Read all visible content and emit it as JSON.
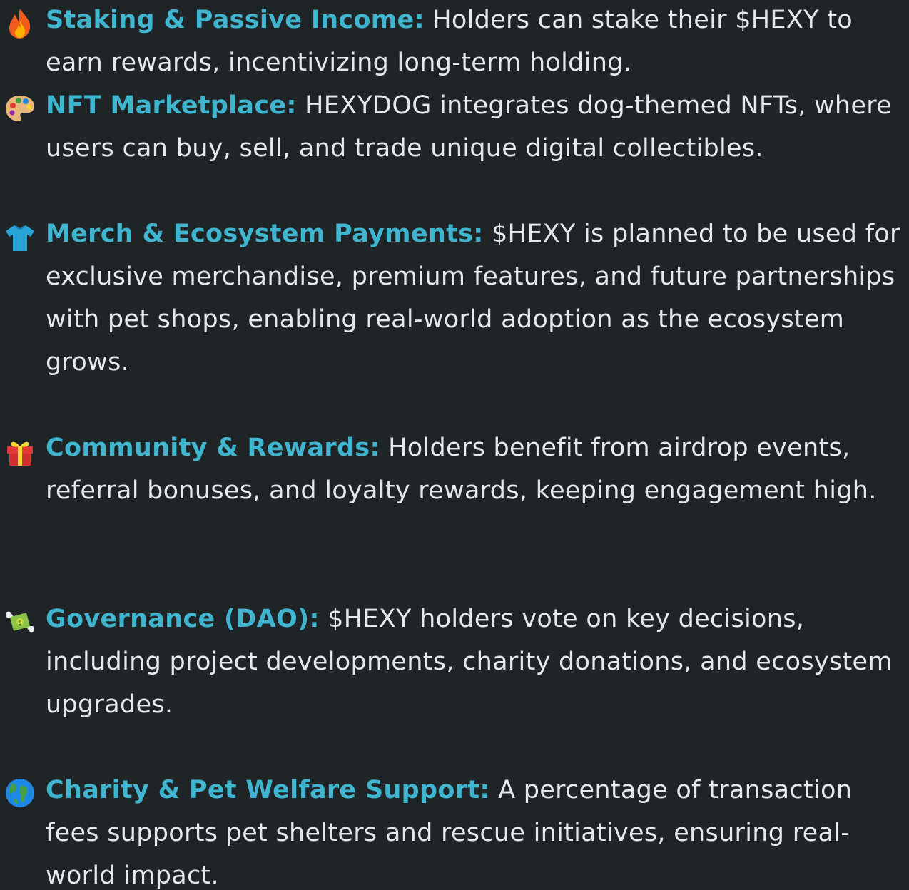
{
  "features": [
    {
      "icon": "fire-icon",
      "title": "Staking & Passive Income:",
      "description": "Holders can stake their $HEXY to earn rewards, incentivizing long-term holding."
    },
    {
      "icon": "artist-palette-icon",
      "title": "NFT Marketplace:",
      "description": "HEXYDOG integrates dog-themed NFTs, where users can buy, sell, and trade unique digital collectibles."
    },
    {
      "icon": "t-shirt-icon",
      "title": "Merch & Ecosystem Payments:",
      "description": "$HEXY is planned to be used for exclusive merchandise, premium features, and future partnerships with pet shops, enabling real-world adoption as the ecosystem grows."
    },
    {
      "icon": "gift-icon",
      "title": "Community & Rewards:",
      "description": "Holders benefit from airdrop events, referral bonuses, and loyalty rewards, keeping engagement high."
    },
    {
      "icon": "money-with-wings-icon",
      "title": "Governance (DAO):",
      "description": "$HEXY holders vote on key decisions, including project developments, charity donations, and ecosystem upgrades."
    },
    {
      "icon": "globe-icon",
      "title": "Charity & Pet Welfare Support:",
      "description": "A percentage of transaction fees supports pet shelters and rescue initiatives, ensuring real-world impact."
    }
  ]
}
